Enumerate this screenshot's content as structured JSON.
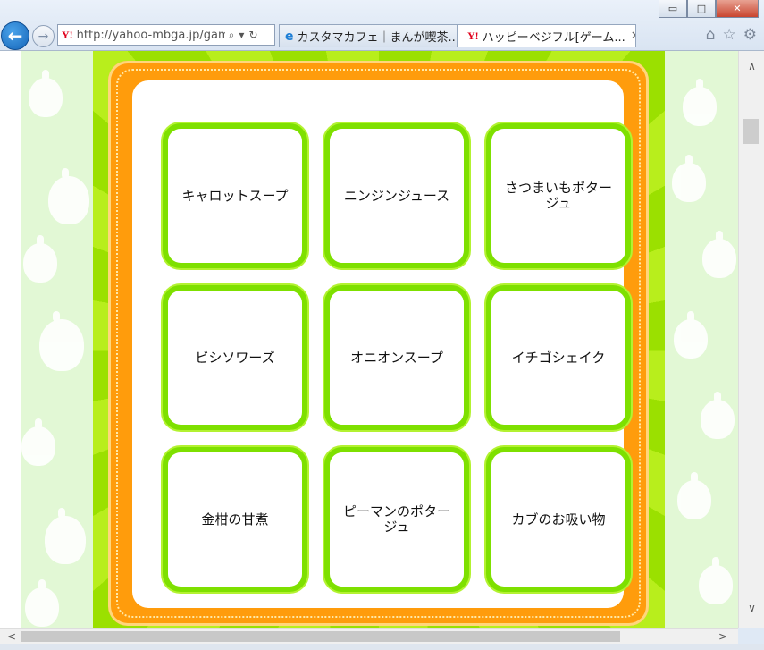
{
  "browser": {
    "address_url": "http://yahoo-mbga.jp/game",
    "address_tools": [
      "⌕",
      "▾",
      "↻"
    ],
    "tabs": [
      {
        "label": "カスタマカフェ｜まんが喫茶..."
      },
      {
        "label": "ハッピーベジフル[ゲーム..."
      }
    ],
    "window_controls": [
      "▭",
      "□",
      "✕"
    ],
    "toolbar_icons": [
      "⌂",
      "☆",
      "⚙"
    ]
  },
  "cards": [
    {
      "label": "キャロットスープ"
    },
    {
      "label": "ニンジンジュース"
    },
    {
      "label": "さつまいもポタージュ"
    },
    {
      "label": "ビシソワーズ"
    },
    {
      "label": "オニオンスープ"
    },
    {
      "label": "イチゴシェイク"
    },
    {
      "label": "金柑の甘煮"
    },
    {
      "label": "ピーマンのポタージュ"
    },
    {
      "label": "カブのお吸い物"
    }
  ],
  "scroll": {
    "up": "∧",
    "down": "∨",
    "left": "<",
    "right": ">"
  }
}
